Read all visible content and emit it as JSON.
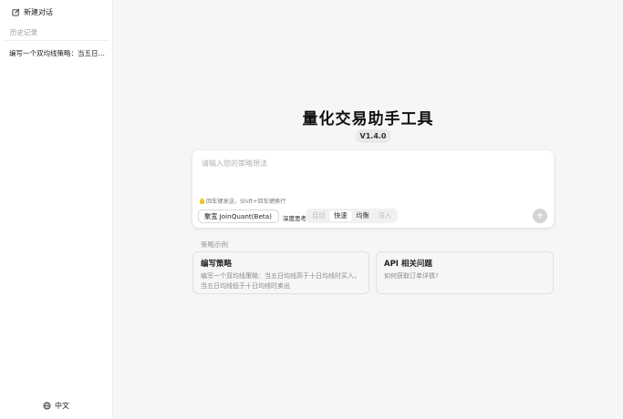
{
  "sidebar": {
    "new_chat_label": "新建对话",
    "history_label": "历史记录",
    "history_items": [
      "编写一个双均线策略：当五日均线高于十日均线时买入，当五日均线低于十日均线时卖出"
    ],
    "language_label": "中文"
  },
  "main": {
    "title": "量化交易助手工具",
    "version": "V1.4.0",
    "input": {
      "placeholder": "请输入您的策略想法",
      "value": ""
    },
    "hint": "回车键发送，Shift+回车键换行",
    "platform_select": "聚宽 JoinQuant(Beta)",
    "depth_label": "深度思考",
    "depth_options": [
      "自动",
      "快速",
      "均衡",
      "深入"
    ],
    "depth_selected": "快速",
    "examples_label": "策略示例",
    "examples": [
      {
        "title": "编写策略",
        "description": "编写一个双均线策略：当五日均线高于十日均线时买入，当五日均线低于十日均线时卖出"
      },
      {
        "title": "API 相关问题",
        "description": "如何获取订单详情?"
      }
    ]
  },
  "icons": {
    "new_chat": "edit-icon",
    "language": "globe-icon",
    "hint": "lightbulb-icon",
    "platform_dropdown": "chevron-down-icon",
    "send": "arrow-up-icon"
  },
  "colors": {
    "background": "#f6f6f6",
    "send_button": "#d4d4d4",
    "bulb": "#f2c230"
  }
}
